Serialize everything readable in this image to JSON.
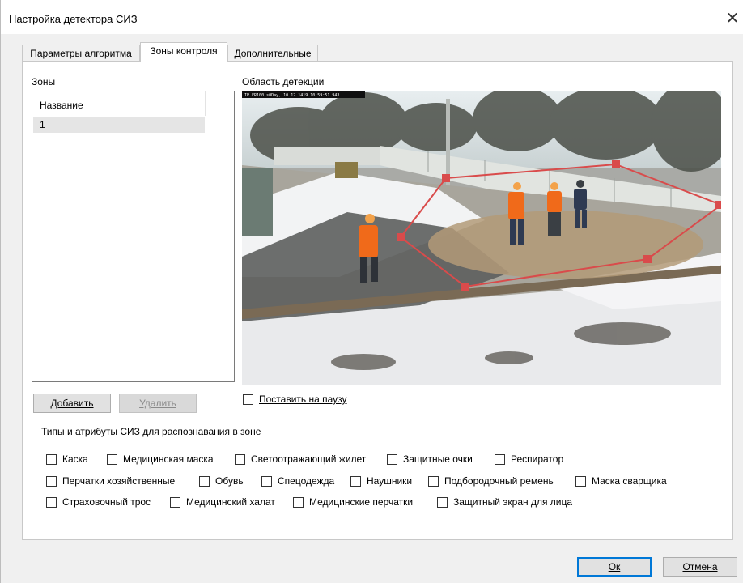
{
  "window": {
    "title": "Настройка детектора СИЗ",
    "close_glyph": "✕"
  },
  "tabs": [
    {
      "label": "Параметры алгоритма",
      "active": false
    },
    {
      "label": "Зоны контроля",
      "active": true
    },
    {
      "label": "Дополнительные",
      "active": false
    }
  ],
  "zones": {
    "label": "Зоны",
    "column_header": "Название",
    "rows": [
      "1"
    ],
    "add_button": "Добавить",
    "delete_button": "Удалить"
  },
  "detection": {
    "label": "Область детекции",
    "camera_overlay": "IP FR100 s0Day, 10 12.1419 10:59:51.943",
    "pause_label": "Поставить на паузу",
    "pause_checked": false
  },
  "ppe": {
    "legend": "Типы и атрибуты СИЗ для распознавания в зоне",
    "row1": [
      "Каска",
      "Медицинская маска",
      "Светоотражающий жилет",
      "Защитные очки",
      "Респиратор"
    ],
    "row2": [
      "Перчатки хозяйственные",
      "Обувь",
      "Спецодежда",
      "Наушники",
      "Подбородочный ремень",
      "Маска сварщика"
    ],
    "row3": [
      "Страховочный трос",
      "Медицинский халат",
      "Медицинские перчатки",
      "Защитный экран для лица"
    ]
  },
  "footer": {
    "ok_button": "Ок",
    "cancel_button": "Отмена"
  },
  "colors": {
    "zone_polygon": "#d94b4b",
    "primary_border": "#0078d7",
    "worker_vest": "#f06a1a"
  }
}
